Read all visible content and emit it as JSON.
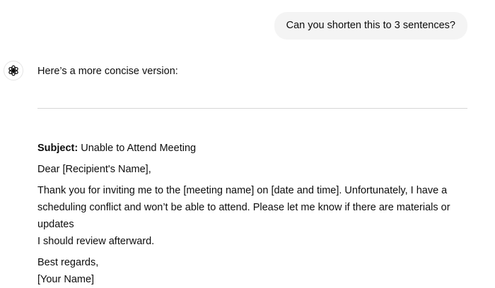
{
  "user_message": {
    "text": "Can you shorten this to 3 sentences?"
  },
  "assistant": {
    "avatar_icon": "openai-logo-icon",
    "intro": "Here’s a more concise version:",
    "email": {
      "subject_label": "Subject:",
      "subject_value": "Unable to Attend Meeting",
      "greeting": "Dear [Recipient's Name],",
      "body_lines": [
        "Thank you for inviting me to the [meeting name] on [date and time]. Unfortunately, I have a",
        "scheduling conflict and won’t be able to attend. Please let me know if there are materials or updates",
        "I should review afterward."
      ],
      "closing": "Best regards,",
      "signature": "[Your Name]"
    }
  }
}
